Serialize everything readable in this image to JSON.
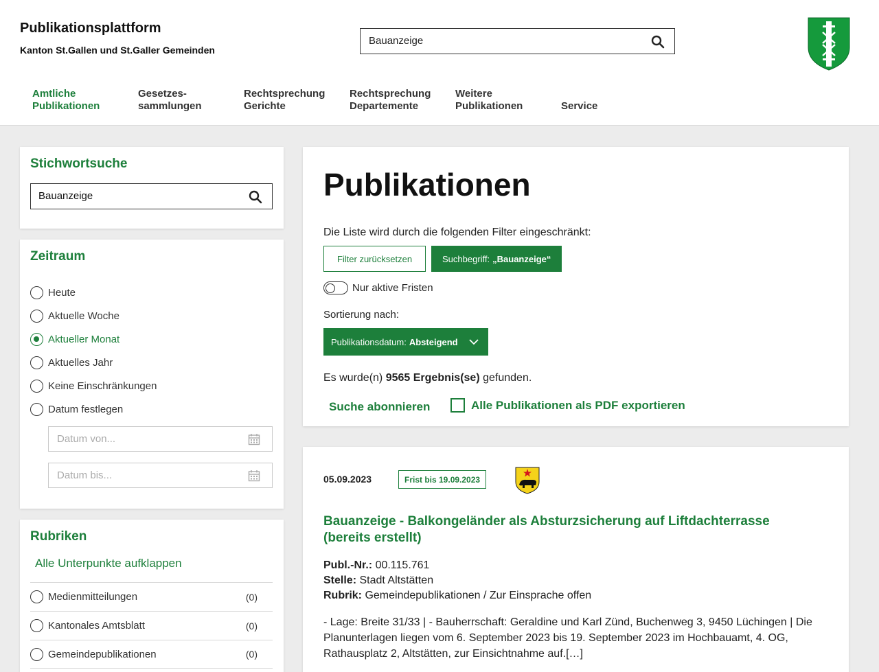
{
  "header": {
    "title": "Publikationsplattform",
    "subtitle": "Kanton St.Gallen und St.Galler Gemeinden",
    "search_value": "Bauanzeige",
    "nav": [
      {
        "line1": "Amtliche",
        "line2": "Publikationen"
      },
      {
        "line1": "Gesetzes-",
        "line2": "sammlungen"
      },
      {
        "line1": "Rechtsprechung",
        "line2": "Gerichte"
      },
      {
        "line1": "Rechtsprechung",
        "line2": "Departemente"
      },
      {
        "line1": "Weitere",
        "line2": "Publikationen"
      },
      {
        "line1": "",
        "line2": "Service"
      }
    ]
  },
  "sidebar": {
    "keyword": {
      "heading": "Stichwortsuche",
      "value": "Bauanzeige"
    },
    "period": {
      "heading": "Zeitraum",
      "options": [
        "Heute",
        "Aktuelle Woche",
        "Aktueller Monat",
        "Aktuelles Jahr",
        "Keine Einschränkungen",
        "Datum festlegen"
      ],
      "selected": "Aktueller Monat",
      "date_from_placeholder": "Datum von...",
      "date_to_placeholder": "Datum bis..."
    },
    "rubriken": {
      "heading": "Rubriken",
      "expand_all": "Alle Unterpunkte aufklappen",
      "items": [
        {
          "label": "Medienmitteilungen",
          "count": "(0)"
        },
        {
          "label": "Kantonales Amtsblatt",
          "count": "(0)"
        },
        {
          "label": "Gemeindepublikationen",
          "count": "(0)"
        }
      ]
    }
  },
  "main": {
    "title": "Publikationen",
    "filter_text": "Die Liste wird durch die folgenden Filter eingeschränkt:",
    "reset_label": "Filter zurücksetzen",
    "search_chip_prefix": "Suchbegriff:",
    "search_chip_value": "„Bauanzeige“",
    "toggle_label": "Nur aktive Fristen",
    "sort_label": "Sortierung nach:",
    "sort_prefix": "Publikationsdatum:",
    "sort_value": "Absteigend",
    "result_prefix": "Es wurde(n)",
    "result_count": "9565 Ergebnis(se)",
    "result_suffix": "gefunden.",
    "subscribe": "Suche abonnieren",
    "export_pdf": "Alle Publikationen als PDF exportieren"
  },
  "result": {
    "date": "05.09.2023",
    "deadline": "Frist bis 19.09.2023",
    "title": "Bauanzeige - Balkongeländer als Absturzsicherung auf Liftdachterrasse (bereits erstellt)",
    "publ_nr_label": "Publ.-Nr.:",
    "publ_nr": "00.115.761",
    "stelle_label": "Stelle:",
    "stelle": "Stadt Altstätten",
    "rubrik_label": "Rubrik:",
    "rubrik": "Gemeindepublikationen / Zur Einsprache offen",
    "excerpt": "- Lage: Breite 31/33 | - Bauherrschaft: Geraldine und Karl Zünd, Buchenweg 3, 9450 Lüchingen | Die Planunterlagen liegen vom 6. September 2023 bis 19. September 2023 im Hochbauamt, 4. OG, Rathausplatz 2, Altstätten, zur Einsichtnahme auf.[…]"
  },
  "colors": {
    "accent": "#1d7f3b",
    "background": "#ececec"
  },
  "icons": [
    "search-icon",
    "calendar-icon",
    "chevron-down-icon",
    "canton-logo",
    "municipality-crest"
  ]
}
